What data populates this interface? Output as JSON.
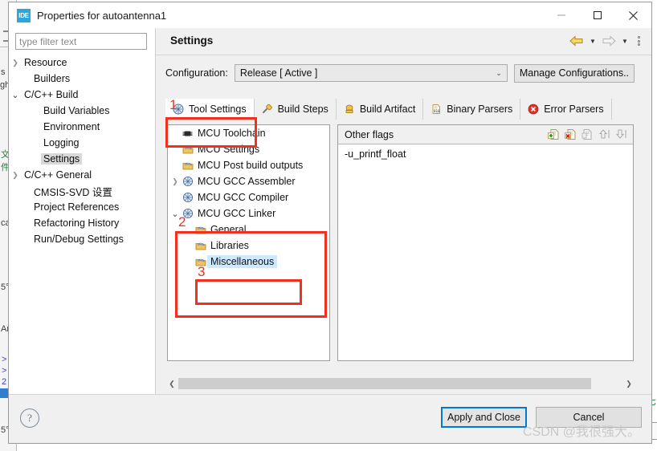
{
  "window": {
    "app_icon_text": "IDE",
    "title": "Properties for autoantenna1",
    "minimize": "minimize",
    "maximize": "maximize",
    "close": "close"
  },
  "sidebar": {
    "filter_placeholder": "type filter text",
    "filter_value": "",
    "items": [
      {
        "label": "Resource",
        "indent": 0,
        "arrow": "›",
        "selected": false
      },
      {
        "label": "Builders",
        "indent": 1,
        "arrow": "",
        "selected": false
      },
      {
        "label": "C/C++ Build",
        "indent": 0,
        "arrow": "⌄",
        "selected": false
      },
      {
        "label": "Build Variables",
        "indent": 2,
        "arrow": "",
        "selected": false
      },
      {
        "label": "Environment",
        "indent": 2,
        "arrow": "",
        "selected": false
      },
      {
        "label": "Logging",
        "indent": 2,
        "arrow": "",
        "selected": false
      },
      {
        "label": "Settings",
        "indent": 2,
        "arrow": "",
        "selected": true
      },
      {
        "label": "C/C++ General",
        "indent": 0,
        "arrow": "›",
        "selected": false
      },
      {
        "label": "CMSIS-SVD 设置",
        "indent": 1,
        "arrow": "",
        "selected": false
      },
      {
        "label": "Project References",
        "indent": 1,
        "arrow": "",
        "selected": false
      },
      {
        "label": "Refactoring History",
        "indent": 1,
        "arrow": "",
        "selected": false
      },
      {
        "label": "Run/Debug Settings",
        "indent": 1,
        "arrow": "",
        "selected": false
      }
    ]
  },
  "header": {
    "title": "Settings",
    "back_label": "Back",
    "forward_label": "Forward",
    "menu_label": "View Menu"
  },
  "configuration": {
    "label": "Configuration:",
    "value": "Release  [ Active ]",
    "manage_button": "Manage Configurations.."
  },
  "tabs": [
    {
      "label": "Tool Settings",
      "icon": "tool-settings-icon",
      "active": true
    },
    {
      "label": "Build Steps",
      "icon": "build-steps-icon",
      "active": false
    },
    {
      "label": "Build Artifact",
      "icon": "build-artifact-icon",
      "active": false
    },
    {
      "label": "Binary Parsers",
      "icon": "binary-parsers-icon",
      "active": false
    },
    {
      "label": "Error Parsers",
      "icon": "error-parsers-icon",
      "active": false
    }
  ],
  "tool_tree": [
    {
      "label": "MCU Toolchain",
      "indent": 0,
      "arrow": "",
      "icon": "chip-icon",
      "selected": false
    },
    {
      "label": "MCU Settings",
      "indent": 0,
      "arrow": "",
      "icon": "folder-icon",
      "selected": false
    },
    {
      "label": "MCU Post build outputs",
      "indent": 0,
      "arrow": "",
      "icon": "folder-icon",
      "selected": false
    },
    {
      "label": "MCU GCC Assembler",
      "indent": 0,
      "arrow": "›",
      "icon": "gear-icon",
      "selected": false
    },
    {
      "label": "MCU GCC Compiler",
      "indent": 0,
      "arrow": "",
      "icon": "gear-icon",
      "selected": false
    },
    {
      "label": "MCU GCC Linker",
      "indent": 0,
      "arrow": "⌄",
      "icon": "gear-icon",
      "selected": false
    },
    {
      "label": "General",
      "indent": 1,
      "arrow": "",
      "icon": "folder-icon",
      "selected": false
    },
    {
      "label": "Libraries",
      "indent": 1,
      "arrow": "",
      "icon": "folder-icon",
      "selected": false
    },
    {
      "label": "Miscellaneous",
      "indent": 1,
      "arrow": "",
      "icon": "folder-icon",
      "selected": true
    }
  ],
  "flags_panel": {
    "title": "Other flags",
    "tools": [
      {
        "name": "add-icon",
        "enabled": true
      },
      {
        "name": "delete-icon",
        "enabled": true
      },
      {
        "name": "edit-icon",
        "enabled": false
      },
      {
        "name": "move-up-icon",
        "enabled": false
      },
      {
        "name": "move-down-icon",
        "enabled": false
      }
    ],
    "items": [
      "-u_printf_float"
    ]
  },
  "footer": {
    "help": "?",
    "apply_and_close": "Apply and Close",
    "cancel": "Cancel"
  },
  "annotations": {
    "numbers": [
      "1",
      "2",
      "3"
    ],
    "accent_color": "#f42f1d"
  },
  "watermark": "CSDN @我很强大。",
  "background_window": {
    "fragments": [
      "s",
      "gh",
      "文件",
      "ca",
      "5°",
      "Ar",
      ">",
      ">",
      "2"
    ]
  }
}
